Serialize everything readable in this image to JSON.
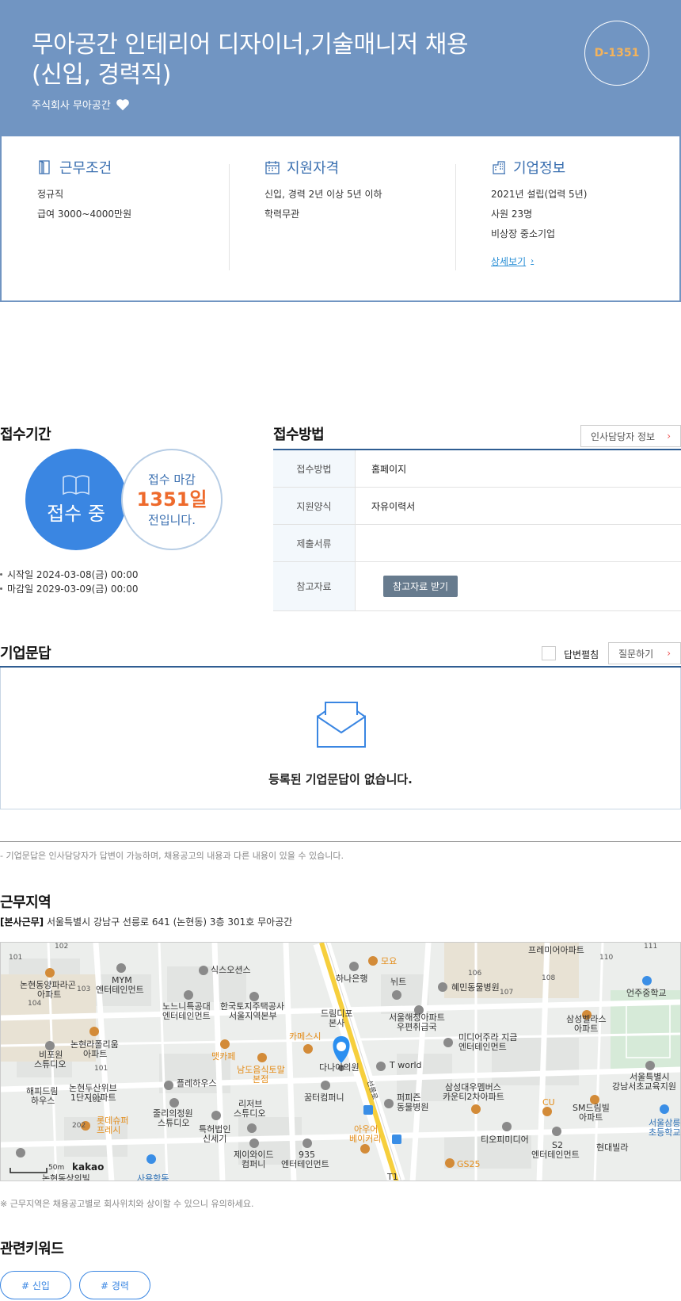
{
  "header": {
    "title_line1": "무아공간 인테리어 디자이너,기술매니저 채용",
    "title_line2": "(신입, 경력직)",
    "company": "주식회사 무아공간",
    "dday": "D-1351"
  },
  "info": {
    "work": {
      "title": "근무조건",
      "lines": [
        "정규직",
        "급여 3000~4000만원"
      ]
    },
    "qual": {
      "title": "지원자격",
      "lines": [
        "신입, 경력 2년 이상 5년 이하",
        "학력무관"
      ]
    },
    "corp": {
      "title": "기업정보",
      "lines": [
        "2021년 설립(업력 5년)",
        "사원 23명",
        "비상장 중소기업"
      ],
      "link": "상세보기"
    }
  },
  "period": {
    "title": "접수기간",
    "status": "접수 중",
    "deadline_l1": "접수 마감",
    "deadline_l2": "1351일",
    "deadline_l3": "전입니다.",
    "start": "시작일 2024-03-08(금) 00:00",
    "end": "마감일 2029-03-09(금) 00:00"
  },
  "method": {
    "title": "접수방법",
    "hr_button": "인사담당자 정보",
    "rows": [
      {
        "key": "접수방법",
        "value": "홈페이지"
      },
      {
        "key": "지원양식",
        "value": "자유이력서"
      },
      {
        "key": "제출서류",
        "value": ""
      },
      {
        "key": "참고자료",
        "button": "참고자료 받기"
      }
    ]
  },
  "qna": {
    "title": "기업문답",
    "checkbox_label": "답변펼침",
    "ask_button": "질문하기",
    "empty": "등록된 기업문답이 없습니다.",
    "note": "- 기업문답은 인사담당자가 답변이 가능하며, 채용공고의 내용과 다른 내용이 있을 수 있습니다."
  },
  "location": {
    "title": "근무지역",
    "addr_label": "[본사근무]",
    "addr": "서울특별시 강남구 선릉로 641 (논현동) 3층 301호 무아공간",
    "note": "※ 근무지역은 채용공고별로 회사위치와 상이할 수 있으니 유의하세요.",
    "map_scale": "50m",
    "map_brand": "kakao",
    "labels": {
      "a1": "논현동양파라곤",
      "a1b": "아파트",
      "a2": "MYM",
      "a2b": "엔터테인먼트",
      "a3": "식스오션스",
      "a4": "하나은행",
      "a5": "모요",
      "a6": "뉘트",
      "a7": "혜민동물병원",
      "a8": "프레미어아파트",
      "a9": "언주중학교",
      "a10": "노느니특공대",
      "a10b": "엔터테인먼트",
      "a11": "한국토지주택공사",
      "a11b": "서울지역본부",
      "a12": "드림디포",
      "a12b": "본사",
      "a13": "서울해청아파트",
      "a13b": "우편취급국",
      "a14": "삼성벨라스",
      "a14b": "아파트",
      "a15": "논현라폴리움",
      "a15b": "아파트",
      "a16": "비포원",
      "a16b": "스튜디오",
      "a17": "카메스시",
      "a18": "맷카페",
      "a19": "미디어주라 지금",
      "a19b": "엔터테인먼트",
      "a20": "남도음식토말",
      "a20b": "본점",
      "a21": "다나아의원",
      "a22": "T world",
      "a23": "논현두산위브",
      "a23b": "1단지아파트",
      "a24": "해피드림",
      "a24b": "하우스",
      "a25": "플레하우스",
      "a26": "꿈터컴퍼니",
      "a27": "삼성대우멤버스",
      "a27b": "카운티2차아파트",
      "a28": "서울특별시",
      "a28b": "강남서초교육지원",
      "a29": "퍼피즌",
      "a29b": "동물병원",
      "a30": "리저브",
      "a30b": "스튜디오",
      "a31": "줄리의정원",
      "a31b": "스튜디오",
      "a32": "롯데슈퍼",
      "a32b": "프레시",
      "a33": "CU",
      "a34": "SM드림빌",
      "a34b": "아파트",
      "a35": "서울삼릉",
      "a35b": "초등학교",
      "a36": "특허법인",
      "a36b": "신세기",
      "a37": "아우어",
      "a37b": "베이커리",
      "a38": "티오피미디어",
      "a39": "S2",
      "a39b": "엔터테인먼트",
      "a40": "현대빌라",
      "a41": "제이와이드",
      "a41b": "컴퍼니",
      "a42": "935",
      "a42b": "엔터테인먼트",
      "a43": "GS25",
      "a44": "논현동상의빌",
      "a45": "사용학동",
      "a46": "선릉로",
      "a47": "T1",
      "n1": "101",
      "n2": "104",
      "n3": "103",
      "n4": "101",
      "n5": "102",
      "n6": "202",
      "n7": "106",
      "n8": "107",
      "n9": "108",
      "n10": "110",
      "n11": "102",
      "n12": "111"
    }
  },
  "keywords": {
    "title": "관련키워드",
    "items": [
      "# 신입",
      "# 경력"
    ]
  },
  "colors": {
    "header_bg": "#7195c2",
    "accent_blue": "#3a86e2",
    "dday": "#f4b35b",
    "deadline": "#ee6a2c"
  }
}
